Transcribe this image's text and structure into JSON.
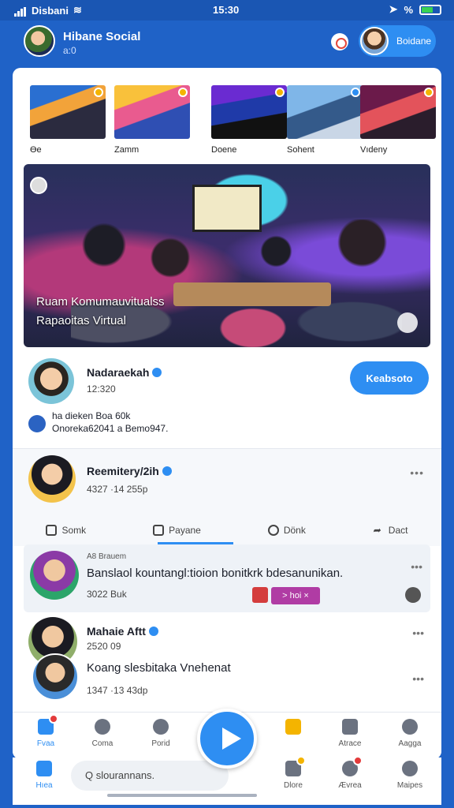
{
  "status": {
    "carrier": "Disbani",
    "time": "15:30",
    "battery": "%"
  },
  "header": {
    "title": "Hibane Social",
    "subtitle": "a:0",
    "profile_label": "Boidane"
  },
  "stories": [
    {
      "label": "Ɵe"
    },
    {
      "label": "Zamm"
    },
    {
      "label": "Doene"
    },
    {
      "label": "Sohent"
    },
    {
      "label": "Vıdeny"
    }
  ],
  "hero": {
    "caption_line1": "Ruam Komumauvitualss",
    "caption_line2": "Rapaoitas Virtual"
  },
  "user1": {
    "name": "Nadaraekah",
    "meta": "12:320",
    "line1": "ha dieken Boa 60k",
    "line2": "Onoreka62041 a Bemo947.",
    "follow_label": "Keabsoto"
  },
  "post": {
    "name": "Reemitery/2ih",
    "meta": "4327 ·14   255p",
    "more": "•••",
    "actions": [
      {
        "label": "Somk"
      },
      {
        "label": "Payane"
      },
      {
        "label": "Dönk"
      },
      {
        "label": "Dact"
      }
    ]
  },
  "nested": {
    "tag": "A8 Brauem",
    "text": "Banslaol kountangl:tioion bonitkrk bdesanunikan.",
    "meta": "3022 Buk",
    "badge_label": "> hoi ×",
    "more": "•••"
  },
  "user3": {
    "name": "Mahaie Aftt",
    "meta1": "2520 09",
    "text": "Koang slesbitaka Vnehenat",
    "meta2": "1347 ·13   43dp",
    "more": "•••"
  },
  "tabs": [
    {
      "label": "Fvaa"
    },
    {
      "label": "Coma"
    },
    {
      "label": "Porid"
    },
    {
      "label": ""
    },
    {
      "label": "Atrace"
    },
    {
      "label": "Aagga"
    }
  ],
  "bottom": {
    "home_label": "Hıea",
    "search_placeholder": "Q slourannans.",
    "alerts_label": "Dlore",
    "messages_label": "Ævrea",
    "profile_label": "Maipes"
  }
}
